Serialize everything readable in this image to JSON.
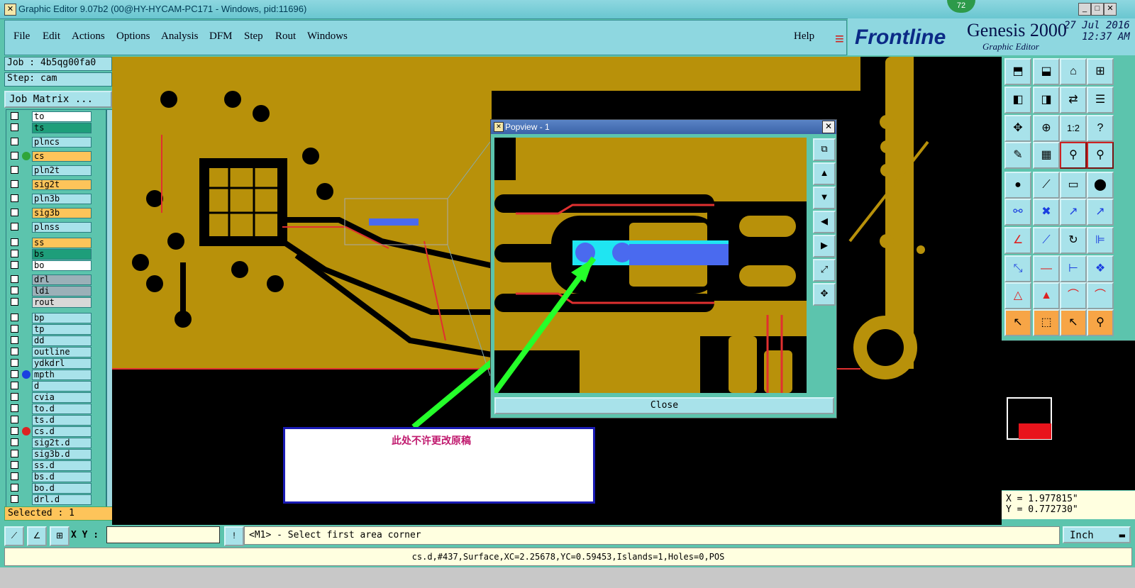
{
  "window": {
    "title": "Graphic Editor 9.07b2 (00@HY-HYCAM-PC171 - Windows, pid:11696)",
    "badge": "72"
  },
  "menu": {
    "file": "File",
    "edit": "Edit",
    "actions": "Actions",
    "options": "Options",
    "analysis": "Analysis",
    "dfm": "DFM",
    "step": "Step",
    "rout": "Rout",
    "windows": "Windows",
    "help": "Help"
  },
  "brand": {
    "logo_text": "Frontline",
    "product": "Genesis 2000",
    "subtitle": "Graphic Editor",
    "date": "27 Jul 2016",
    "time": "12:37 AM"
  },
  "job": {
    "job_line": "Job : 4b5qg00fa0",
    "step_line": "Step: cam",
    "matrix_button": "Job Matrix ..."
  },
  "layers": [
    {
      "name": "to",
      "color": "#ffffff",
      "dot": ""
    },
    {
      "name": "ts",
      "color": "#1e9e7a",
      "dot": ""
    },
    {
      "name": "plncs",
      "color": "#a8e2ea",
      "dot": ""
    },
    {
      "name": "cs",
      "color": "#fdc45a",
      "dot": "#2fa53a"
    },
    {
      "name": "pln2t",
      "color": "#a8e2ea",
      "dot": ""
    },
    {
      "name": "sig2t",
      "color": "#fdc45a",
      "dot": ""
    },
    {
      "name": "pln3b",
      "color": "#a8e2ea",
      "dot": ""
    },
    {
      "name": "sig3b",
      "color": "#fdc45a",
      "dot": ""
    },
    {
      "name": "plnss",
      "color": "#a8e2ea",
      "dot": ""
    },
    {
      "name": "ss",
      "color": "#fdc45a",
      "dot": ""
    },
    {
      "name": "bs",
      "color": "#1e9e7a",
      "dot": ""
    },
    {
      "name": "bo",
      "color": "#ffffff",
      "dot": ""
    },
    {
      "name": "drl",
      "color": "#9bb0b8",
      "dot": ""
    },
    {
      "name": "ldi",
      "color": "#9bb0b8",
      "dot": ""
    },
    {
      "name": "rout",
      "color": "#d8d8d8",
      "dot": ""
    },
    {
      "name": "bp",
      "color": "#a8e2ea",
      "dot": ""
    },
    {
      "name": "tp",
      "color": "#a8e2ea",
      "dot": ""
    },
    {
      "name": "dd",
      "color": "#a8e2ea",
      "dot": ""
    },
    {
      "name": "outline",
      "color": "#a8e2ea",
      "dot": ""
    },
    {
      "name": "ydkdrl",
      "color": "#a8e2ea",
      "dot": ""
    },
    {
      "name": "mpth",
      "color": "#a8e2ea",
      "dot": "#1a3fe0"
    },
    {
      "name": "d",
      "color": "#a8e2ea",
      "dot": ""
    },
    {
      "name": "cvia",
      "color": "#a8e2ea",
      "dot": ""
    },
    {
      "name": "to.d",
      "color": "#a8e2ea",
      "dot": ""
    },
    {
      "name": "ts.d",
      "color": "#a8e2ea",
      "dot": ""
    },
    {
      "name": "cs.d",
      "color": "#a8e2ea",
      "dot": "#d22"
    },
    {
      "name": "sig2t.d",
      "color": "#a8e2ea",
      "dot": ""
    },
    {
      "name": "sig3b.d",
      "color": "#a8e2ea",
      "dot": ""
    },
    {
      "name": "ss.d",
      "color": "#a8e2ea",
      "dot": ""
    },
    {
      "name": "bs.d",
      "color": "#a8e2ea",
      "dot": ""
    },
    {
      "name": "bo.d",
      "color": "#a8e2ea",
      "dot": ""
    },
    {
      "name": "drl.d",
      "color": "#a8e2ea",
      "dot": ""
    }
  ],
  "selected_label": "Selected : 1",
  "popview": {
    "title": "Popview - 1",
    "close_button": "Close"
  },
  "annotation": {
    "text": "此处不许更改原稿"
  },
  "coords": {
    "x": "X = 1.977815\"",
    "y": "Y = 0.772730\""
  },
  "command": {
    "xy_label": "X Y :",
    "xy_value": "",
    "message": "<M1> - Select first area corner",
    "unit": "Inch"
  },
  "status": {
    "text": "cs.d,#437,Surface,XC=2.25678,YC=0.59453,Islands=1,Holes=0,POS"
  }
}
